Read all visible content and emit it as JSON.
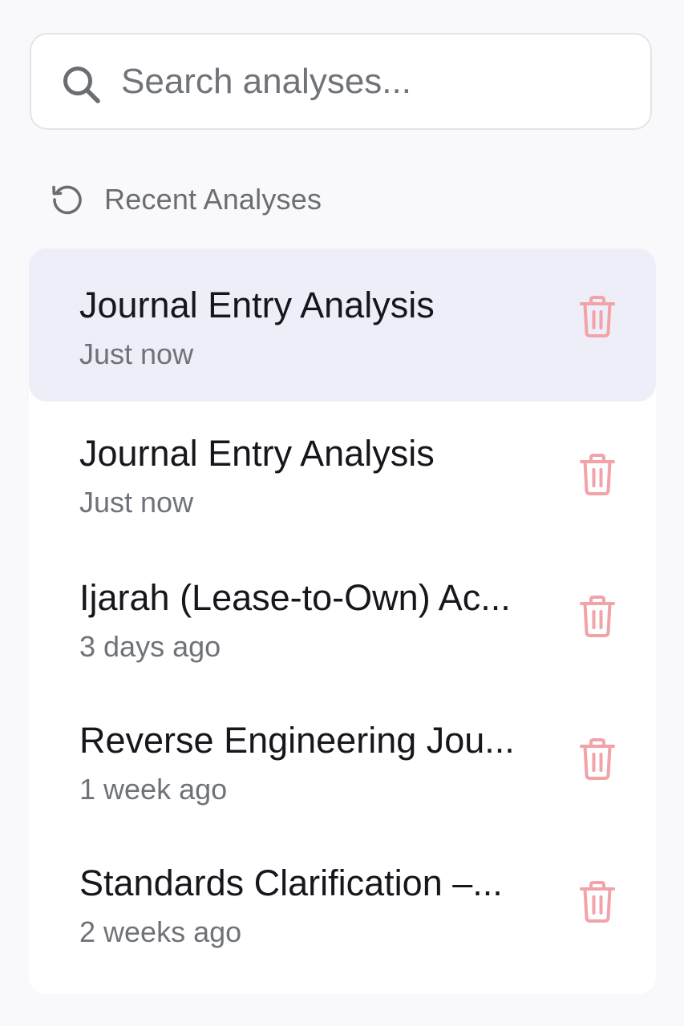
{
  "search": {
    "placeholder": "Search analyses...",
    "value": ""
  },
  "section": {
    "title": "Recent Analyses",
    "icon": "history-icon"
  },
  "colors": {
    "active_background": "#eeeef8",
    "delete_icon": "#f2a3a8",
    "muted_text": "#6f7278"
  },
  "analyses": [
    {
      "title": "Journal Entry Analysis",
      "time": "Just now",
      "active": true
    },
    {
      "title": "Journal Entry Analysis",
      "time": "Just now",
      "active": false
    },
    {
      "title": "Ijarah (Lease-to-Own) Ac...",
      "time": "3 days ago",
      "active": false
    },
    {
      "title": "Reverse Engineering Jou...",
      "time": "1 week ago",
      "active": false
    },
    {
      "title": "Standards Clarification –...",
      "time": "2 weeks ago",
      "active": false
    }
  ]
}
